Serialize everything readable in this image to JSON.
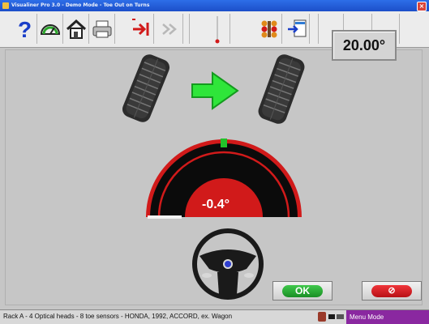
{
  "window": {
    "title": "Visualiner Pro 3.0 - Demo Mode - Toe Out on Turns",
    "close_symbol": "×"
  },
  "toolbar": {
    "items": [
      {
        "name": "help",
        "icon": "question-mark-icon"
      },
      {
        "name": "gauge",
        "icon": "gauge-icon"
      },
      {
        "name": "home",
        "icon": "home-icon"
      },
      {
        "name": "print",
        "icon": "printer-icon"
      },
      {
        "name": "next",
        "icon": "arrow-to-line-icon"
      },
      {
        "name": "skip",
        "icon": "double-chevron-icon"
      },
      {
        "name": "marker",
        "icon": "red-marker-icon"
      },
      {
        "name": "sensors",
        "icon": "sensors-icon"
      },
      {
        "name": "import",
        "icon": "import-document-icon"
      }
    ]
  },
  "measurement": {
    "angle_value": "20.00°",
    "gauge_value": "-0.4°",
    "direction_arrow": "right-arrow-icon"
  },
  "buttons": {
    "ok_label": "OK",
    "cancel_symbol": "⊘"
  },
  "status": {
    "text": "Rack A - 4 Optical heads - 8 toe sensors - HONDA, 1992, ACCORD, ex. Wagon",
    "mode_label": "Menu Mode"
  },
  "colors": {
    "accent_red": "#d11a1a",
    "gauge_black": "#0b0b0b",
    "gauge_marker_green": "#22c22a",
    "arrow_green": "#2fe53a",
    "mode_purple": "#8a28a0",
    "titlebar_blue": "#1c4fc9"
  }
}
